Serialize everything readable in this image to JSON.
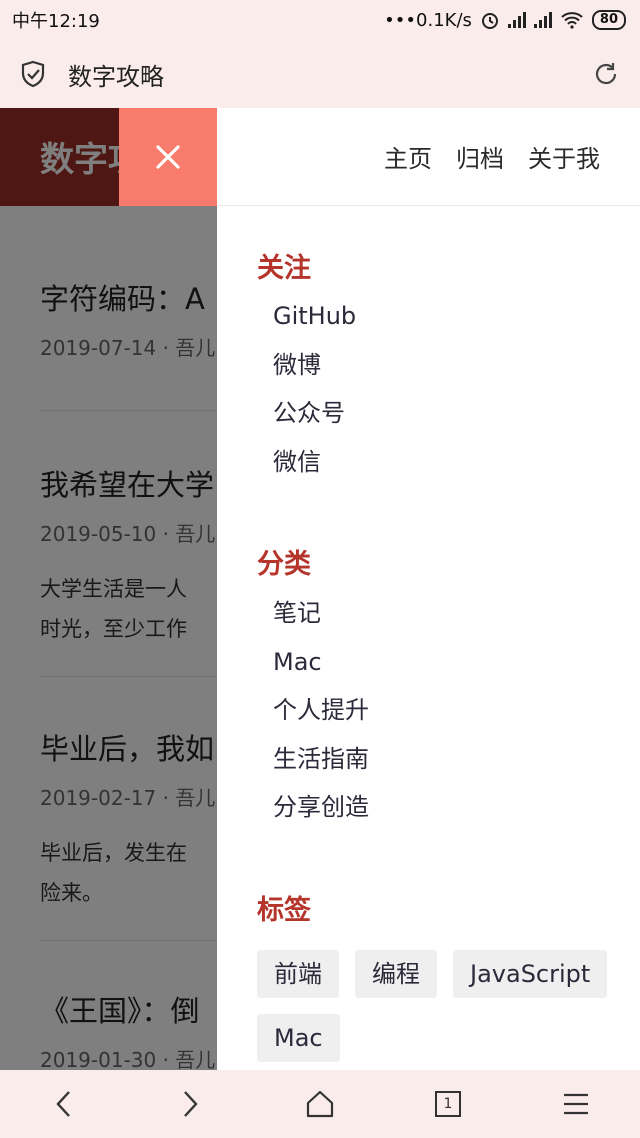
{
  "status_bar": {
    "time": "中午12:19",
    "network_speed": "•••0.1K/s",
    "battery": "80"
  },
  "browser": {
    "page_title": "数字攻略",
    "tab_count": "1"
  },
  "site": {
    "logo": "数字攻略",
    "nav": [
      "主页",
      "归档",
      "关于我"
    ]
  },
  "posts": [
    {
      "title": "字符编码：A",
      "meta": "2019-07-14 · 吾儿",
      "excerpt": ""
    },
    {
      "title": "我希望在大学",
      "meta": "2019-05-10 · 吾儿",
      "excerpt": "大学生活是一人\n时光，至少工作"
    },
    {
      "title": "毕业后，我如",
      "meta": "2019-02-17 · 吾儿",
      "excerpt": "毕业后，发生在\n险来。"
    },
    {
      "title": "《王国》：倒",
      "meta": "2019-01-30 · 吾儿",
      "excerpt": ""
    }
  ],
  "drawer": {
    "follow": {
      "title": "关注",
      "items": [
        "GitHub",
        "微博",
        "公众号",
        "微信"
      ]
    },
    "categories": {
      "title": "分类",
      "items": [
        "笔记",
        "Mac",
        "个人提升",
        "生活指南",
        "分享创造"
      ]
    },
    "tags": {
      "title": "标签",
      "items": [
        "前端",
        "编程",
        "JavaScript",
        "Mac"
      ]
    }
  },
  "colors": {
    "accent": "#b5352b",
    "header_bg": "#9d2e26",
    "close_button_bg": "#f97b6c",
    "browser_chrome": "#fbecec"
  },
  "icons": {
    "shield": "shield-check-icon",
    "refresh": "refresh-icon",
    "close": "close-icon",
    "back": "chevron-left-icon",
    "forward": "chevron-right-icon",
    "home": "home-icon",
    "tabs": "tabs-icon",
    "menu": "menu-icon"
  }
}
